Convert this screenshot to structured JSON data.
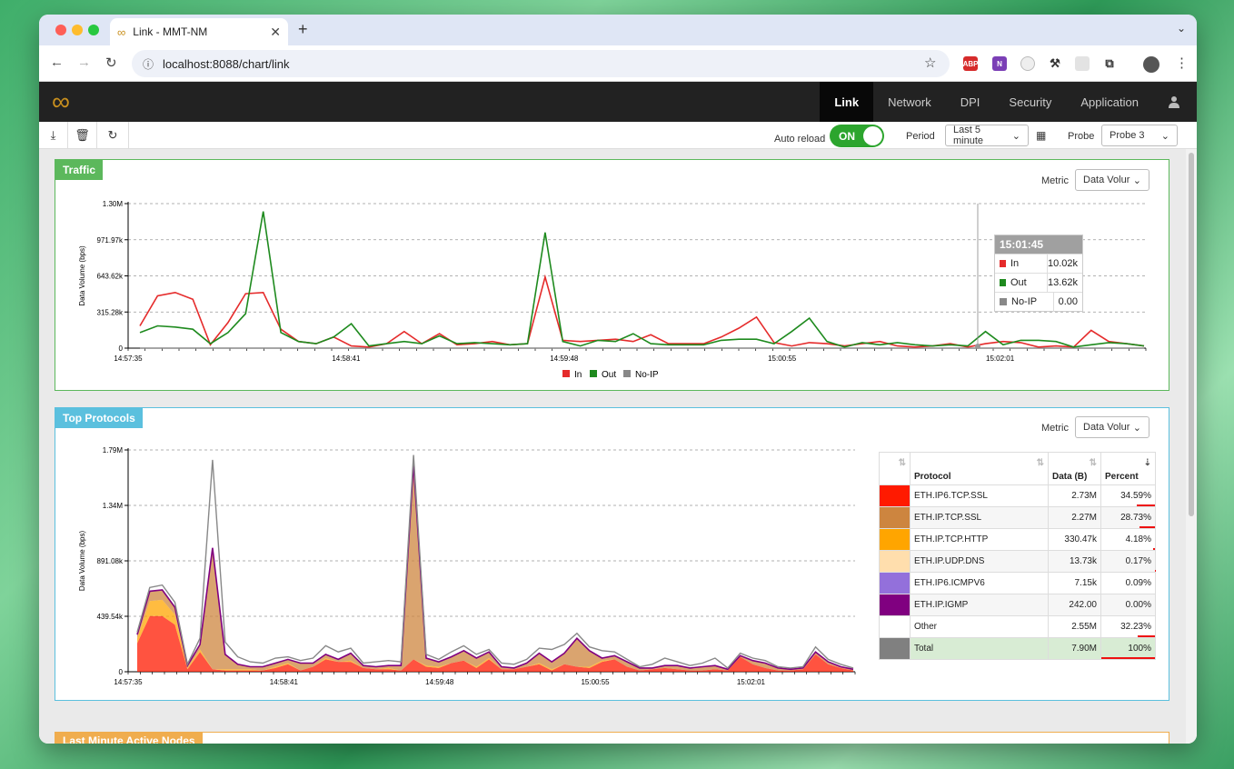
{
  "browser": {
    "tab_title": "Link - MMT-NM",
    "url": "localhost:8088/chart/link",
    "ext_abp": "ABP",
    "ext_onenote": "N"
  },
  "navbar": {
    "items": [
      "Link",
      "Network",
      "DPI",
      "Security",
      "Application"
    ],
    "active": "Link"
  },
  "toolbar": {
    "auto_reload_label": "Auto reload",
    "auto_reload_state": "ON",
    "period_label": "Period",
    "period_value": "Last 5 minute",
    "probe_label": "Probe",
    "probe_value": "Probe 3"
  },
  "traffic_panel": {
    "title": "Traffic",
    "metric_label": "Metric",
    "metric_value": "Data Volur",
    "tooltip": {
      "time": "15:01:45",
      "rows": [
        {
          "name": "In",
          "value": "10.02k",
          "color": "#e52b2b"
        },
        {
          "name": "Out",
          "value": "13.62k",
          "color": "#1e8a1e"
        },
        {
          "name": "No-IP",
          "value": "0.00",
          "color": "#888888"
        }
      ]
    }
  },
  "protocols_panel": {
    "title": "Top Protocols",
    "metric_label": "Metric",
    "metric_value": "Data Volur",
    "table": {
      "headers": {
        "protocol": "Protocol",
        "data": "Data (B)",
        "percent": "Percent"
      },
      "rows": [
        {
          "color": "#ff1a00",
          "protocol": "ETH.IP6.TCP.SSL",
          "data": "2.73M",
          "percent": "34.59%",
          "pct": 34.59
        },
        {
          "color": "#cd853f",
          "protocol": "ETH.IP.TCP.SSL",
          "data": "2.27M",
          "percent": "28.73%",
          "pct": 28.73
        },
        {
          "color": "#ffa500",
          "protocol": "ETH.IP.TCP.HTTP",
          "data": "330.47k",
          "percent": "4.18%",
          "pct": 4.18
        },
        {
          "color": "#ffdead",
          "protocol": "ETH.IP.UDP.DNS",
          "data": "13.73k",
          "percent": "0.17%",
          "pct": 0.17
        },
        {
          "color": "#9370db",
          "protocol": "ETH.IP6.ICMPV6",
          "data": "7.15k",
          "percent": "0.09%",
          "pct": 0.09
        },
        {
          "color": "#800080",
          "protocol": "ETH.IP.IGMP",
          "data": "242.00",
          "percent": "0.00%",
          "pct": 0.0
        },
        {
          "color": "#ffffff",
          "protocol": "Other",
          "data": "2.55M",
          "percent": "32.23%",
          "pct": 32.23
        }
      ],
      "total": {
        "color": "#808080",
        "protocol": "Total",
        "data": "7.90M",
        "percent": "100%",
        "pct": 100
      }
    }
  },
  "next_panel": {
    "title": "Last Minute Active Nodes"
  },
  "chart_data": [
    {
      "type": "line",
      "title": "Traffic",
      "ylabel": "Data Volume (bps)",
      "ylim": [
        0,
        1300000
      ],
      "ytick_labels": [
        "0",
        "315.28k",
        "643.62k",
        "971.97k",
        "1.30M"
      ],
      "xtick_labels": [
        "14:57:35",
        "14:58:41",
        "14:59:48",
        "15:00:55",
        "15:02:01"
      ],
      "x_range": [
        "14:57:35",
        "15:02:45"
      ],
      "grid": true,
      "legend": "bottom",
      "series": [
        {
          "name": "In",
          "color": "#e52b2b",
          "values": [
            200000,
            470000,
            500000,
            440000,
            30000,
            230000,
            490000,
            500000,
            170000,
            60000,
            40000,
            100000,
            20000,
            10000,
            40000,
            150000,
            40000,
            130000,
            30000,
            40000,
            60000,
            30000,
            40000,
            640000,
            70000,
            60000,
            70000,
            80000,
            60000,
            120000,
            40000,
            40000,
            40000,
            100000,
            180000,
            280000,
            50000,
            20000,
            50000,
            40000,
            20000,
            40000,
            60000,
            20000,
            10000,
            20000,
            40000,
            10000,
            40000,
            60000,
            50000,
            10000,
            20000,
            10000,
            160000,
            60000,
            40000,
            20000
          ]
        },
        {
          "name": "Out",
          "color": "#1e8a1e",
          "values": [
            140000,
            200000,
            190000,
            170000,
            40000,
            140000,
            310000,
            1230000,
            140000,
            60000,
            40000,
            100000,
            220000,
            20000,
            40000,
            60000,
            40000,
            110000,
            40000,
            50000,
            40000,
            30000,
            40000,
            1040000,
            60000,
            20000,
            70000,
            60000,
            130000,
            40000,
            30000,
            30000,
            30000,
            70000,
            80000,
            80000,
            40000,
            150000,
            270000,
            60000,
            10000,
            50000,
            30000,
            50000,
            30000,
            20000,
            30000,
            20000,
            150000,
            30000,
            70000,
            70000,
            60000,
            10000,
            30000,
            50000,
            40000,
            20000
          ]
        },
        {
          "name": "No-IP",
          "color": "#888888",
          "values": [
            0,
            0,
            0,
            0,
            0,
            0,
            0,
            0,
            0,
            0,
            0,
            0,
            0,
            0,
            0,
            0,
            0,
            0,
            0,
            0,
            0,
            0,
            0,
            0,
            0,
            0,
            0,
            0,
            0,
            0,
            0,
            0,
            0,
            0,
            0,
            0,
            0,
            0,
            0,
            0,
            0,
            0,
            0,
            0,
            0,
            0,
            0,
            0,
            0,
            0,
            0,
            0,
            0,
            0,
            0,
            0,
            0,
            0
          ]
        }
      ]
    },
    {
      "type": "area",
      "title": "Top Protocols",
      "ylabel": "Data Volume (bps)",
      "ylim": [
        0,
        1790000
      ],
      "ytick_labels": [
        "0",
        "439.54k",
        "891.08k",
        "1.34M",
        "1.79M"
      ],
      "xtick_labels": [
        "14:57:35",
        "14:58:41",
        "14:59:48",
        "15:00:55",
        "15:02:01"
      ],
      "x_range": [
        "14:57:35",
        "15:02:45"
      ],
      "grid": true,
      "stacked": true,
      "series": [
        {
          "name": "ETH.IP6.TCP.SSL",
          "color": "#ff1a00",
          "values": [
            230000,
            450000,
            450000,
            380000,
            20000,
            160000,
            20000,
            10000,
            10000,
            10000,
            10000,
            30000,
            60000,
            10000,
            40000,
            100000,
            80000,
            80000,
            30000,
            20000,
            20000,
            10000,
            100000,
            40000,
            30000,
            70000,
            90000,
            30000,
            100000,
            20000,
            20000,
            40000,
            60000,
            10000,
            60000,
            40000,
            30000,
            80000,
            100000,
            40000,
            10000,
            20000,
            30000,
            20000,
            10000,
            10000,
            20000,
            10000,
            120000,
            60000,
            30000,
            10000,
            10000,
            20000,
            140000,
            60000,
            30000,
            10000
          ]
        },
        {
          "name": "ETH.IP.TCP.SSL",
          "color": "#cd853f",
          "values": [
            30000,
            80000,
            80000,
            60000,
            20000,
            40000,
            980000,
            120000,
            40000,
            20000,
            30000,
            30000,
            30000,
            60000,
            30000,
            30000,
            20000,
            60000,
            20000,
            20000,
            20000,
            40000,
            1580000,
            60000,
            40000,
            50000,
            80000,
            70000,
            50000,
            20000,
            10000,
            30000,
            80000,
            60000,
            90000,
            230000,
            130000,
            20000,
            30000,
            40000,
            20000,
            10000,
            20000,
            30000,
            20000,
            30000,
            30000,
            10000,
            10000,
            30000,
            40000,
            20000,
            10000,
            10000,
            20000,
            20000,
            10000,
            10000
          ]
        },
        {
          "name": "ETH.IP.TCP.HTTP",
          "color": "#ffa500",
          "values": [
            40000,
            120000,
            130000,
            80000,
            10000,
            20000,
            0,
            10000,
            10000,
            10000,
            0,
            10000,
            10000,
            0,
            0,
            10000,
            0,
            10000,
            0,
            0,
            10000,
            0,
            0,
            10000,
            10000,
            0,
            0,
            10000,
            10000,
            0,
            0,
            0,
            10000,
            10000,
            0,
            0,
            10000,
            10000,
            0,
            0,
            0,
            0,
            0,
            0,
            0,
            0,
            0,
            0,
            0,
            0,
            0,
            0,
            0,
            0,
            0,
            0,
            0,
            0
          ]
        },
        {
          "name": "ETH.IP.UDP.DNS",
          "color": "#ffdead",
          "values": [
            0,
            0,
            0,
            0,
            0,
            0,
            0,
            0,
            0,
            0,
            0,
            0,
            0,
            0,
            0,
            0,
            0,
            0,
            0,
            0,
            0,
            0,
            0,
            0,
            0,
            0,
            0,
            0,
            0,
            0,
            0,
            0,
            0,
            0,
            0,
            0,
            0,
            0,
            0,
            0,
            0,
            0,
            0,
            0,
            0,
            0,
            0,
            0,
            0,
            0,
            0,
            0,
            0,
            0,
            0,
            0,
            0,
            0
          ]
        },
        {
          "name": "ETH.IP6.ICMPV6",
          "color": "#9370db",
          "values": [
            0,
            0,
            0,
            0,
            0,
            0,
            0,
            0,
            0,
            0,
            0,
            0,
            0,
            0,
            0,
            0,
            0,
            0,
            0,
            0,
            0,
            0,
            0,
            0,
            0,
            0,
            0,
            0,
            0,
            0,
            0,
            0,
            0,
            0,
            0,
            0,
            0,
            0,
            0,
            0,
            0,
            0,
            0,
            0,
            0,
            0,
            0,
            0,
            0,
            0,
            0,
            0,
            0,
            0,
            0,
            0,
            0,
            0
          ]
        },
        {
          "name": "ETH.IP.IGMP",
          "color": "#800080",
          "values": [
            0,
            0,
            0,
            0,
            0,
            0,
            0,
            0,
            0,
            0,
            0,
            0,
            0,
            0,
            0,
            0,
            0,
            0,
            0,
            0,
            0,
            0,
            0,
            0,
            0,
            0,
            0,
            0,
            0,
            0,
            0,
            0,
            0,
            0,
            0,
            0,
            0,
            0,
            0,
            0,
            0,
            0,
            0,
            0,
            0,
            0,
            0,
            0,
            0,
            0,
            0,
            0,
            0,
            0,
            0,
            0,
            0,
            0
          ]
        },
        {
          "name": "Other",
          "color": "#888888",
          "values": [
            20000,
            30000,
            40000,
            40000,
            10000,
            50000,
            710000,
            100000,
            60000,
            40000,
            30000,
            40000,
            20000,
            20000,
            40000,
            70000,
            60000,
            40000,
            20000,
            40000,
            40000,
            30000,
            70000,
            30000,
            20000,
            40000,
            40000,
            30000,
            20000,
            30000,
            30000,
            30000,
            40000,
            100000,
            70000,
            40000,
            30000,
            60000,
            30000,
            20000,
            10000,
            30000,
            60000,
            30000,
            20000,
            30000,
            60000,
            10000,
            20000,
            20000,
            20000,
            10000,
            10000,
            10000,
            40000,
            20000,
            20000,
            10000
          ]
        }
      ]
    }
  ]
}
